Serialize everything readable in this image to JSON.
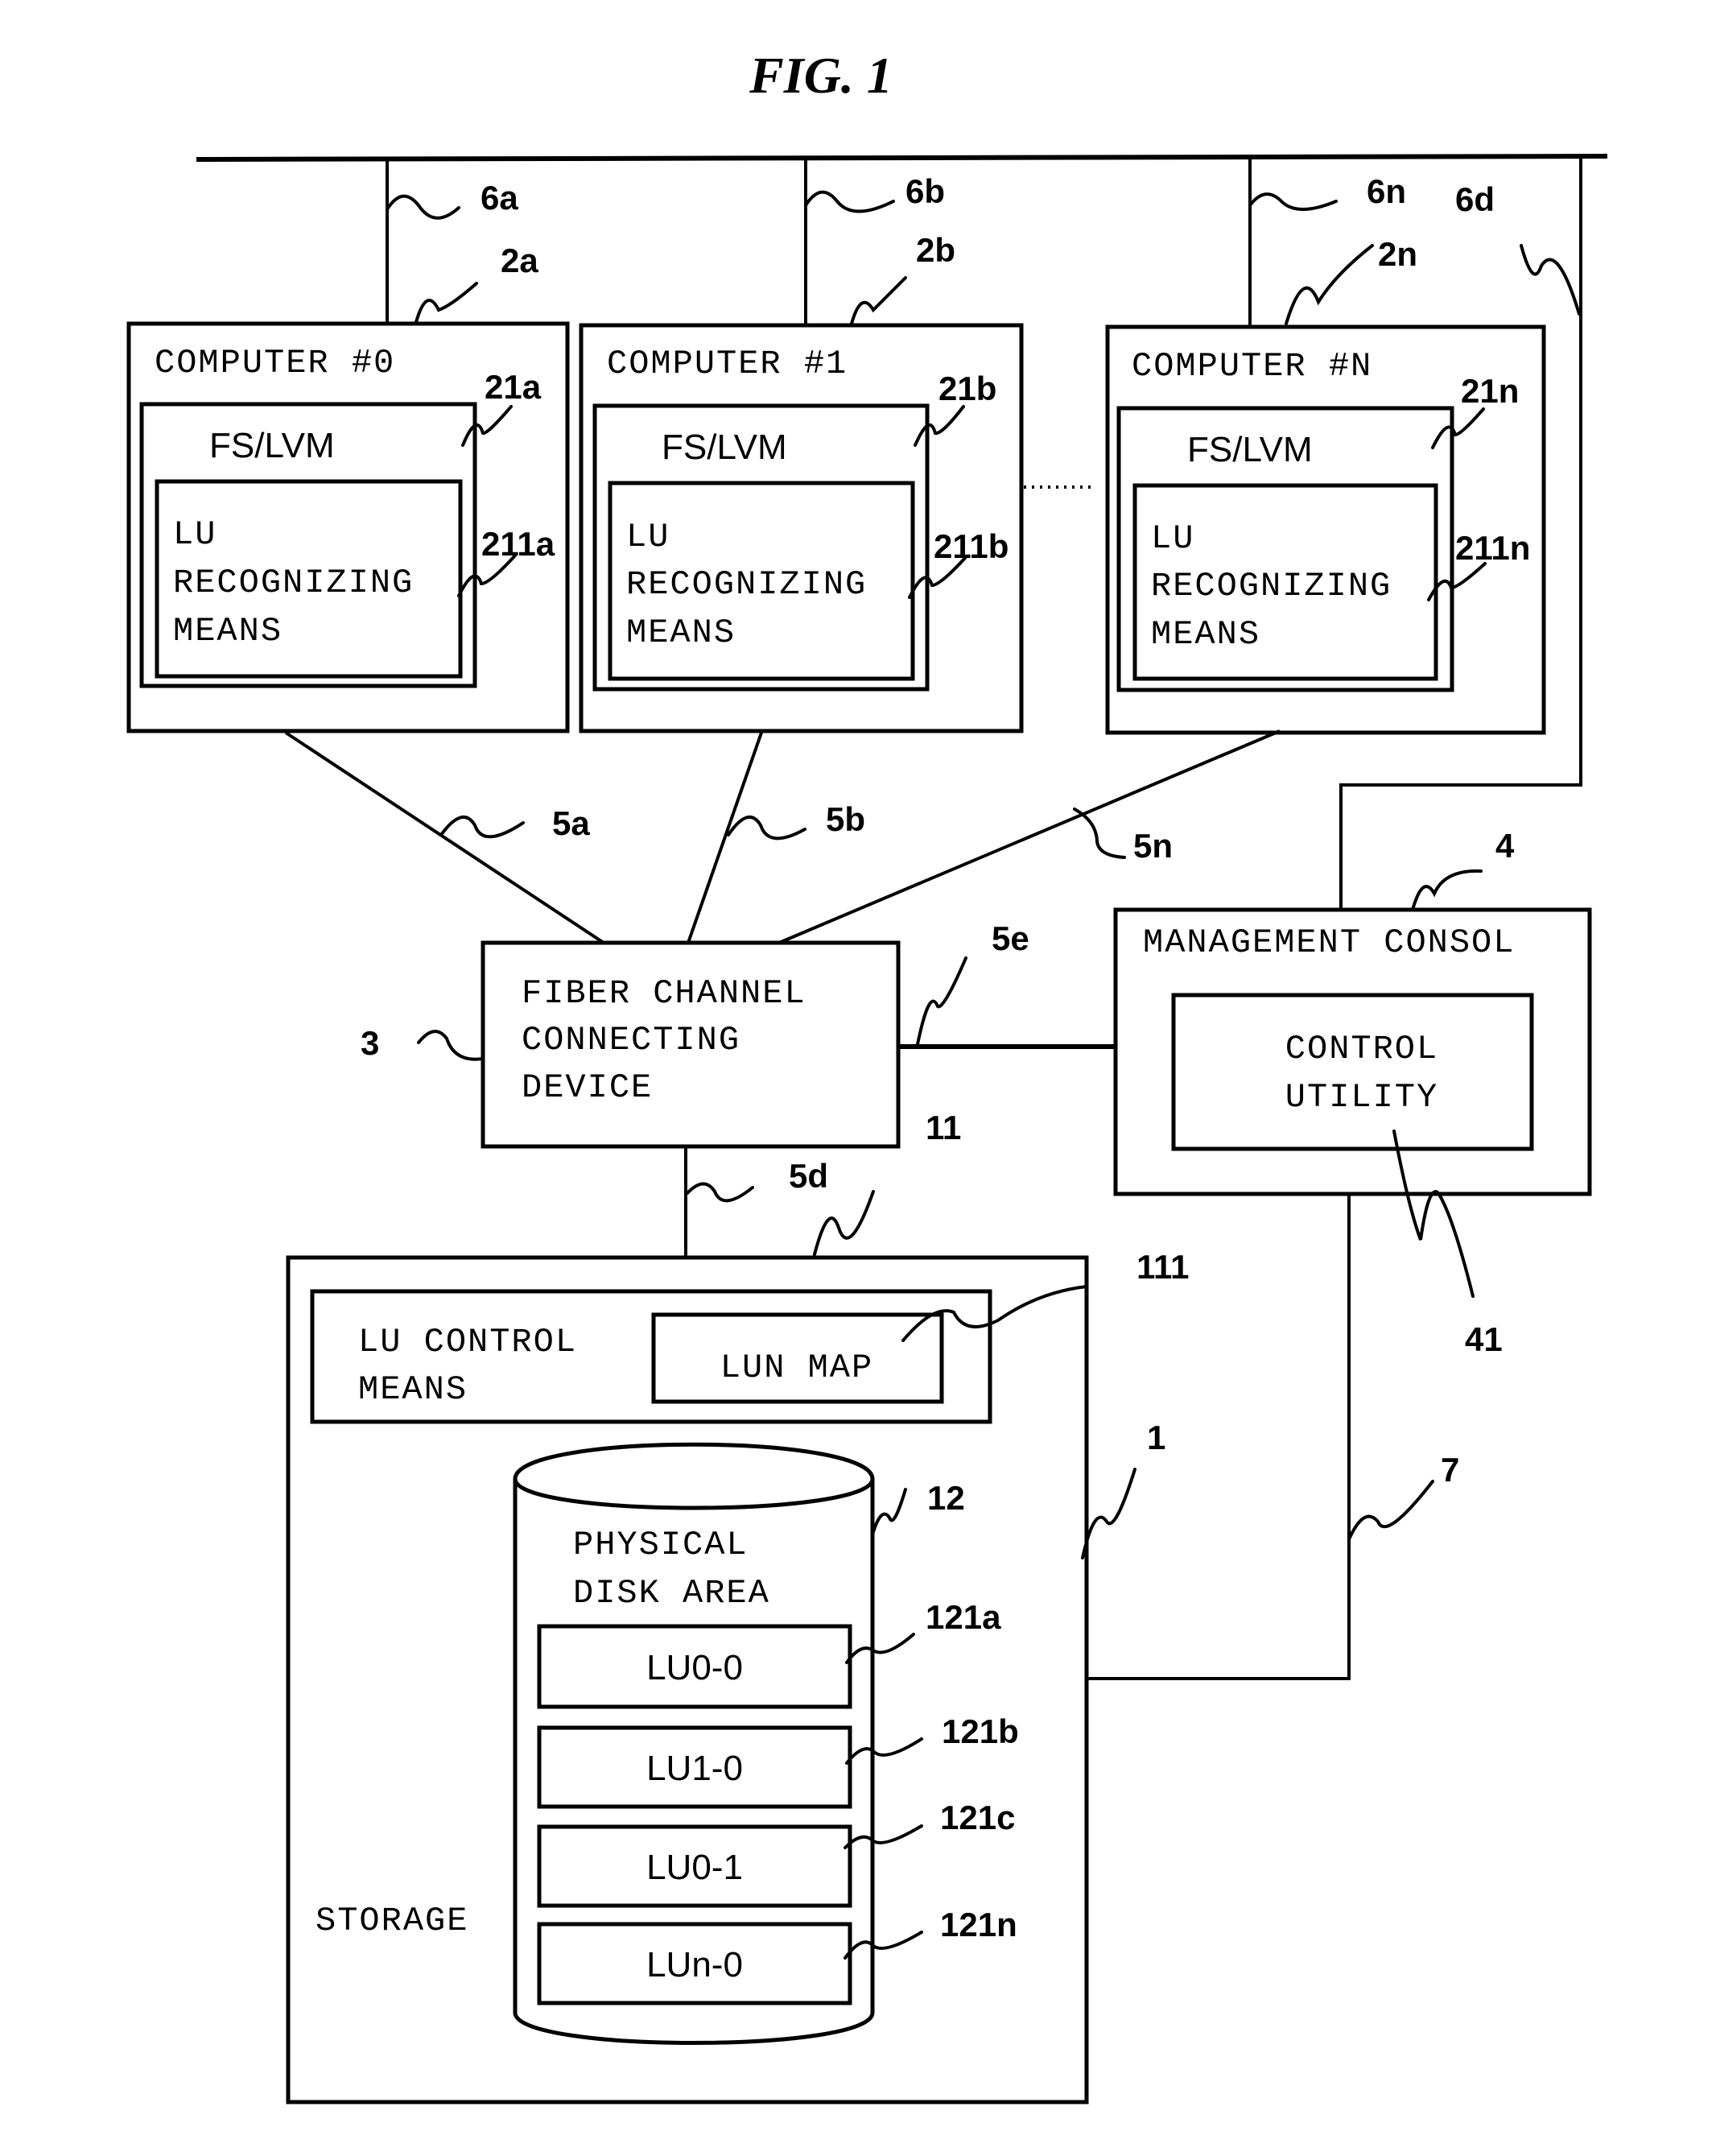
{
  "figure": {
    "title": "FIG. 1"
  },
  "network": {
    "bus_refs": [
      "6a",
      "6b",
      "6n",
      "6d"
    ]
  },
  "computers": [
    {
      "label": "COMPUTER #0",
      "ref": "2a",
      "fs_label": "FS/LVM",
      "fs_ref": "21a",
      "lu_lines": [
        "LU",
        "RECOGNIZING",
        "MEANS"
      ],
      "lu_ref": "211a",
      "link_ref": "5a",
      "bus_ref": "6a"
    },
    {
      "label": "COMPUTER #1",
      "ref": "2b",
      "fs_label": "FS/LVM",
      "fs_ref": "21b",
      "lu_lines": [
        "LU",
        "RECOGNIZING",
        "MEANS"
      ],
      "lu_ref": "211b",
      "link_ref": "5b",
      "bus_ref": "6b"
    },
    {
      "label": "COMPUTER #N",
      "ref": "2n",
      "fs_label": "FS/LVM",
      "fs_ref": "21n",
      "lu_lines": [
        "LU",
        "RECOGNIZING",
        "MEANS"
      ],
      "lu_ref": "211n",
      "link_ref": "5n",
      "bus_ref": "6n"
    }
  ],
  "fiber_channel": {
    "lines": [
      "FIBER CHANNEL",
      "CONNECTING",
      "DEVICE"
    ],
    "ref": "3",
    "to_console_ref": "5e",
    "to_storage_ref": "5d"
  },
  "management_console": {
    "label": "MANAGEMENT CONSOL",
    "ref": "4",
    "bus_ref": "6d",
    "control_utility_lines": [
      "CONTROL",
      "UTILITY"
    ],
    "control_utility_ref": "41",
    "storage_link_ref": "7"
  },
  "storage": {
    "label": "STORAGE",
    "ref": "1",
    "lu_control": {
      "lines": [
        "LU CONTROL",
        "MEANS"
      ],
      "ref": "11",
      "lun_map_label": "LUN MAP",
      "lun_map_ref": "111"
    },
    "physical_disk": {
      "lines": [
        "PHYSICAL",
        "DISK AREA"
      ],
      "ref": "12",
      "lus": [
        {
          "label": "LU0-0",
          "ref": "121a"
        },
        {
          "label": "LU1-0",
          "ref": "121b"
        },
        {
          "label": "LU0-1",
          "ref": "121c"
        },
        {
          "label": "LUn-0",
          "ref": "121n"
        }
      ]
    }
  }
}
